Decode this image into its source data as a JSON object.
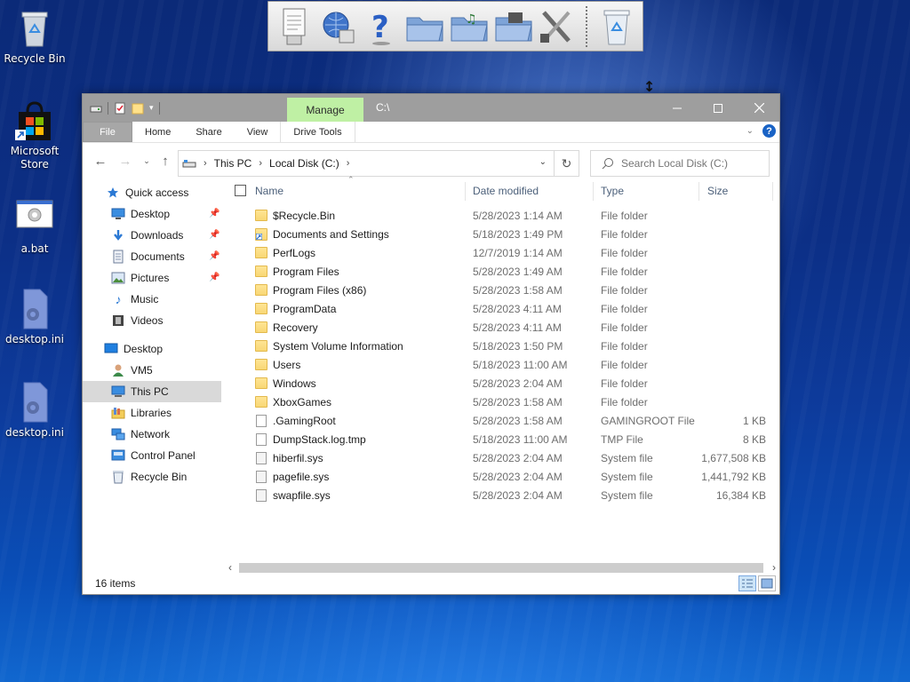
{
  "desktop": {
    "icons": [
      {
        "label": "Recycle Bin",
        "icon": "recycle-bin-icon"
      },
      {
        "label": "Microsoft Store",
        "icon": "microsoft-store-icon"
      },
      {
        "label": "a.bat",
        "icon": "batch-file-icon"
      },
      {
        "label": "desktop.ini",
        "icon": "ini-file-icon"
      },
      {
        "label": "desktop.ini",
        "icon": "ini-file-icon"
      }
    ]
  },
  "dock": {
    "items": [
      "notepad-icon",
      "globe-network-icon",
      "help-question-icon",
      "folder-icon",
      "music-folder-icon",
      "video-folder-icon",
      "tools-icon",
      "recycle-bin-icon"
    ]
  },
  "window": {
    "title": "C:\\",
    "manage_tab": "Manage",
    "ribbon_tabs": [
      "File",
      "Home",
      "Share",
      "View",
      "Drive Tools"
    ],
    "address": {
      "crumbs": [
        "This PC",
        "Local Disk (C:)"
      ]
    },
    "search_placeholder": "Search Local Disk (C:)",
    "nav": [
      {
        "label": "Quick access",
        "icon": "star-icon",
        "pinned": false
      },
      {
        "label": "Desktop",
        "icon": "desktop-icon",
        "pinned": true
      },
      {
        "label": "Downloads",
        "icon": "download-arrow-icon",
        "pinned": true
      },
      {
        "label": "Documents",
        "icon": "documents-icon",
        "pinned": true
      },
      {
        "label": "Pictures",
        "icon": "pictures-icon",
        "pinned": true
      },
      {
        "label": "Music",
        "icon": "music-note-icon",
        "pinned": false
      },
      {
        "label": "Videos",
        "icon": "film-icon",
        "pinned": false
      },
      {
        "label": "Desktop",
        "icon": "desktop-icon",
        "pinned": false
      },
      {
        "label": "VM5",
        "icon": "user-icon",
        "pinned": false
      },
      {
        "label": "This PC",
        "icon": "computer-icon",
        "pinned": false
      },
      {
        "label": "Libraries",
        "icon": "libraries-icon",
        "pinned": false
      },
      {
        "label": "Network",
        "icon": "network-icon",
        "pinned": false
      },
      {
        "label": "Control Panel",
        "icon": "control-panel-icon",
        "pinned": false
      },
      {
        "label": "Recycle Bin",
        "icon": "recycle-bin-icon",
        "pinned": false
      }
    ],
    "columns": [
      "Name",
      "Date modified",
      "Type",
      "Size"
    ],
    "files": [
      {
        "name": "$Recycle.Bin",
        "date": "5/28/2023 1:14 AM",
        "type": "File folder",
        "size": "",
        "kind": "folder"
      },
      {
        "name": "Documents and Settings",
        "date": "5/18/2023 1:49 PM",
        "type": "File folder",
        "size": "",
        "kind": "folder-link"
      },
      {
        "name": "PerfLogs",
        "date": "12/7/2019 1:14 AM",
        "type": "File folder",
        "size": "",
        "kind": "folder"
      },
      {
        "name": "Program Files",
        "date": "5/28/2023 1:49 AM",
        "type": "File folder",
        "size": "",
        "kind": "folder"
      },
      {
        "name": "Program Files (x86)",
        "date": "5/28/2023 1:58 AM",
        "type": "File folder",
        "size": "",
        "kind": "folder"
      },
      {
        "name": "ProgramData",
        "date": "5/28/2023 4:11 AM",
        "type": "File folder",
        "size": "",
        "kind": "folder"
      },
      {
        "name": "Recovery",
        "date": "5/28/2023 4:11 AM",
        "type": "File folder",
        "size": "",
        "kind": "folder"
      },
      {
        "name": "System Volume Information",
        "date": "5/18/2023 1:50 PM",
        "type": "File folder",
        "size": "",
        "kind": "folder"
      },
      {
        "name": "Users",
        "date": "5/18/2023 11:00 AM",
        "type": "File folder",
        "size": "",
        "kind": "folder"
      },
      {
        "name": "Windows",
        "date": "5/28/2023 2:04 AM",
        "type": "File folder",
        "size": "",
        "kind": "folder"
      },
      {
        "name": "XboxGames",
        "date": "5/28/2023 1:58 AM",
        "type": "File folder",
        "size": "",
        "kind": "folder"
      },
      {
        "name": ".GamingRoot",
        "date": "5/28/2023 1:58 AM",
        "type": "GAMINGROOT File",
        "size": "1 KB",
        "kind": "file"
      },
      {
        "name": "DumpStack.log.tmp",
        "date": "5/18/2023 11:00 AM",
        "type": "TMP File",
        "size": "8 KB",
        "kind": "file"
      },
      {
        "name": "hiberfil.sys",
        "date": "5/28/2023 2:04 AM",
        "type": "System file",
        "size": "1,677,508 KB",
        "kind": "sys"
      },
      {
        "name": "pagefile.sys",
        "date": "5/28/2023 2:04 AM",
        "type": "System file",
        "size": "1,441,792 KB",
        "kind": "sys"
      },
      {
        "name": "swapfile.sys",
        "date": "5/28/2023 2:04 AM",
        "type": "System file",
        "size": "16,384 KB",
        "kind": "sys"
      }
    ],
    "status": "16 items"
  }
}
